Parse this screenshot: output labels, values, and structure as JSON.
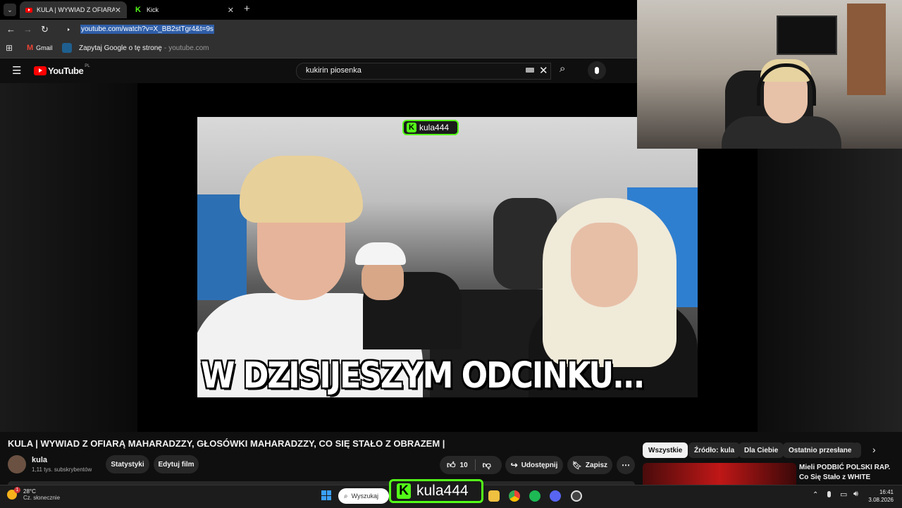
{
  "browser": {
    "tabs": [
      {
        "title": "KULA | WYWIAD Z OFIARĄ MAHARADZZY, GŁOSÓWKI",
        "active": true
      },
      {
        "title": "Kick",
        "active": false
      }
    ],
    "url": "youtube.com/watch?v=X_BB2stTgr4&t=9s",
    "bookmarks": {
      "gmail": "Gmail",
      "ask_google": "Zapytaj Google o tę stronę",
      "ask_google_domain": "youtube.com"
    }
  },
  "youtube": {
    "logo": "YouTube",
    "region": "PL",
    "search_value": "kukirin piosenka"
  },
  "video": {
    "caption": "W DZISIJESZYM ODCINKU...",
    "watermark": "kula444",
    "title": "KULA | WYWIAD Z OFIARĄ MAHARADZZY, GŁOSÓWKI MAHARADZZY, CO SIĘ STAŁO Z OBRAZEM |",
    "channel": "kula",
    "subscribers": "1,11 tys. subskrybentów",
    "buttons": {
      "stats": "Statystyki",
      "edit": "Edytuj film",
      "likes": "10",
      "share": "Udostępnij",
      "save": "Zapisz"
    }
  },
  "chips": [
    "Wszystkie",
    "Źródło: kula",
    "Dla Ciebie",
    "Ostatnio przesłane"
  ],
  "recommended": {
    "title_line1": "Mieli PODBIĆ POLSKI RAP.",
    "title_line2": "Co Się Stało z WHITE"
  },
  "overlay": {
    "kick_name": "kula444"
  },
  "taskbar": {
    "weather_temp": "28°C",
    "weather_desc": "Cz. słonecznie",
    "search_placeholder": "Wyszukaj",
    "time": "16:41",
    "date": "3.08.2026",
    "notif_count": "1"
  },
  "colors": {
    "kick_green": "#53fc18",
    "yt_red": "#ff0000",
    "url_highlight": "#2f5ea8"
  }
}
